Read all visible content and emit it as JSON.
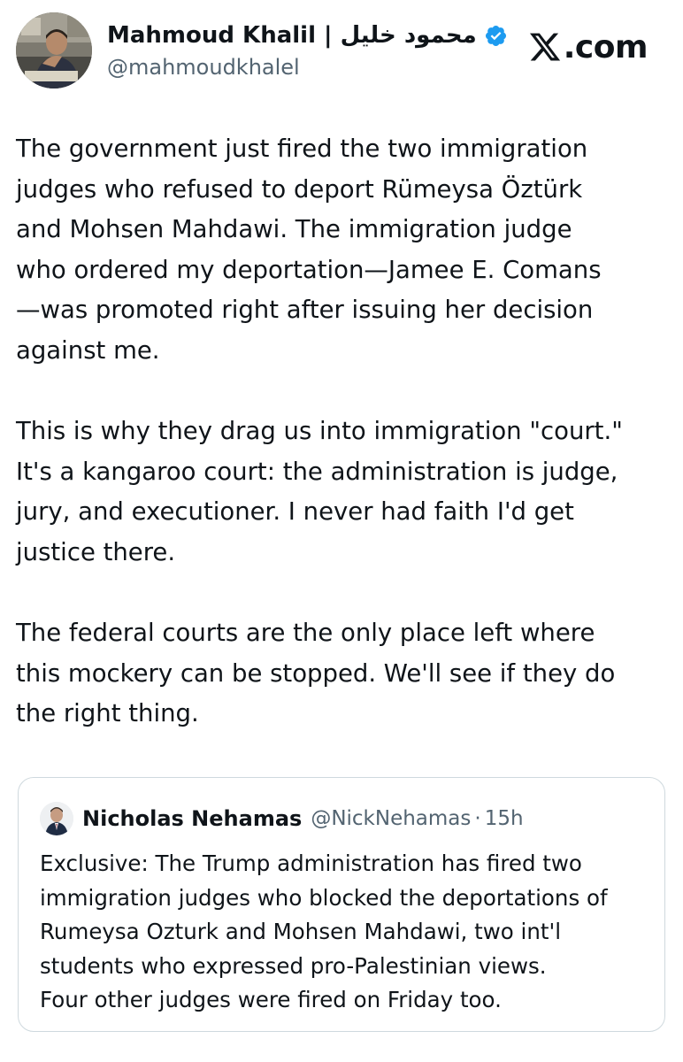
{
  "brand": {
    "domain": ".com",
    "icon": "x-logo-icon"
  },
  "author": {
    "display_name": "Mahmoud Khalil | محمود خليل",
    "handle": "@mahmoudkhalel",
    "verified": true,
    "avatar_icon": "profile-photo"
  },
  "tweet": {
    "paragraphs": [
      "The government just fired the two immigration\njudges who refused to deport Rümeysa Öztürk\nand Mohsen Mahdawi. The immigration judge\nwho ordered my deportation—Jamee E. Comans\n—was promoted right after issuing her decision\nagainst me.",
      "This is why they drag us into immigration \"court.\"\nIt's a kangaroo court: the administration is judge,\njury, and executioner. I never had faith I'd get\njustice there.",
      "The federal courts are the only place left where\nthis mockery can be stopped. We'll see if they do\nthe right thing."
    ]
  },
  "quoted_tweet": {
    "display_name": "Nicholas Nehamas",
    "handle": "@NickNehamas",
    "separator": "·",
    "time": "15h",
    "text": "Exclusive: The Trump administration has fired two\nimmigration judges who blocked the deportations of\nRumeysa Ozturk and Mohsen Mahdawi, two int'l\nstudents who expressed pro-Palestinian views.\nFour other judges were fired on Friday too."
  },
  "colors": {
    "text": "#0f1419",
    "secondary": "#536471",
    "verified_blue": "#1d9bf0",
    "border": "#cfd9de"
  }
}
